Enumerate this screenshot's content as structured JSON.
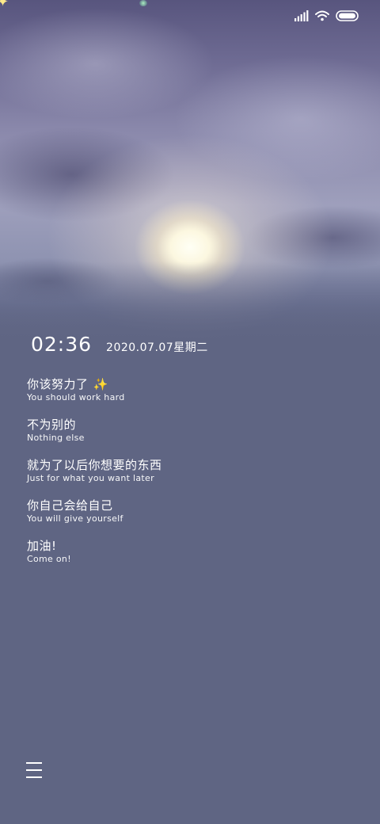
{
  "status_bar": {
    "icons": [
      "signal-icon",
      "wifi-icon",
      "battery-icon"
    ]
  },
  "lockscreen": {
    "time": "02:36",
    "date": "2020.07.07星期二"
  },
  "quotes": [
    {
      "zh": "你该努力了",
      "en": "You should work hard",
      "emoji": "✨"
    },
    {
      "zh": "不为别的",
      "en": "Nothing else"
    },
    {
      "zh": "就为了以后你想要的东西",
      "en": "Just for what you want later"
    },
    {
      "zh": "你自己会给自己",
      "en": "You will give yourself"
    },
    {
      "zh": "加油!",
      "en": "Come on!"
    }
  ],
  "menu": {
    "icon": "menu-icon"
  },
  "colors": {
    "background": "#5f6583",
    "text": "#ffffff",
    "sparkle": "#ffd75a"
  }
}
